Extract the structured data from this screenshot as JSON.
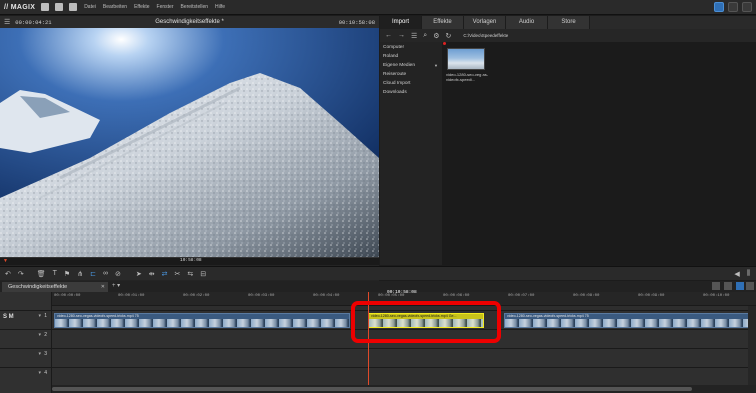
{
  "menubar": {
    "logo": "// MAGIX",
    "items": [
      "Datei",
      "Bearbeiten",
      "Effekte",
      "Fenster",
      "Bereitstellen",
      "Hilfe"
    ]
  },
  "monitor": {
    "timecode_left": "00:00:04:21",
    "title": "Geschwindigkeitseffekte *",
    "timecode_right": "00:10:58:08",
    "ruler_timecode": "10:58:08",
    "controls": [
      "[",
      "]",
      "[←",
      "|◀",
      "▶",
      "[▶]",
      "→]",
      "●"
    ]
  },
  "pool": {
    "tabs": [
      "Import",
      "Effekte",
      "Vorlagen",
      "Audio",
      "Store"
    ],
    "active_tab": "Import",
    "path": "C:\\Video\\Speedeffekte",
    "sidebar": [
      "Computer",
      "Roland",
      "Eigene Medien",
      "Reiseroute",
      "Cloud Import",
      "Downloads"
    ],
    "file_label": "video-1280-seo-veg as-videofx-speedi..."
  },
  "timeline": {
    "project_tab": "Geschwindigkeitseffekte",
    "ruler_timecode": "00:10:58:08",
    "ticks": [
      "00:00:00:00",
      "00:00:01:00",
      "00:00:02:00",
      "00:00:03:00",
      "00:00:04:00",
      "00:00:05:00",
      "00:00:06:00",
      "00:00:07:00",
      "00:00:08:00",
      "00:00:09:00",
      "00:00:10:00"
    ],
    "tracks": [
      "1",
      "2",
      "3",
      "4"
    ],
    "clip1_title": "video-1280-seo-vegas-videofx-speed-tricks.mp4  75",
    "clip2_title": "video-1280-seo-vegas-videofx-speed-tricks.mp4  Ge...",
    "clip3_title": "video-1280-seo-vegas-videofx-speed-tricks.mp4  75"
  },
  "colors": {
    "accent": "#2f6fb5",
    "highlight": "#e00000",
    "selected_clip": "#c8c21a",
    "playhead": "#e04a2a"
  }
}
